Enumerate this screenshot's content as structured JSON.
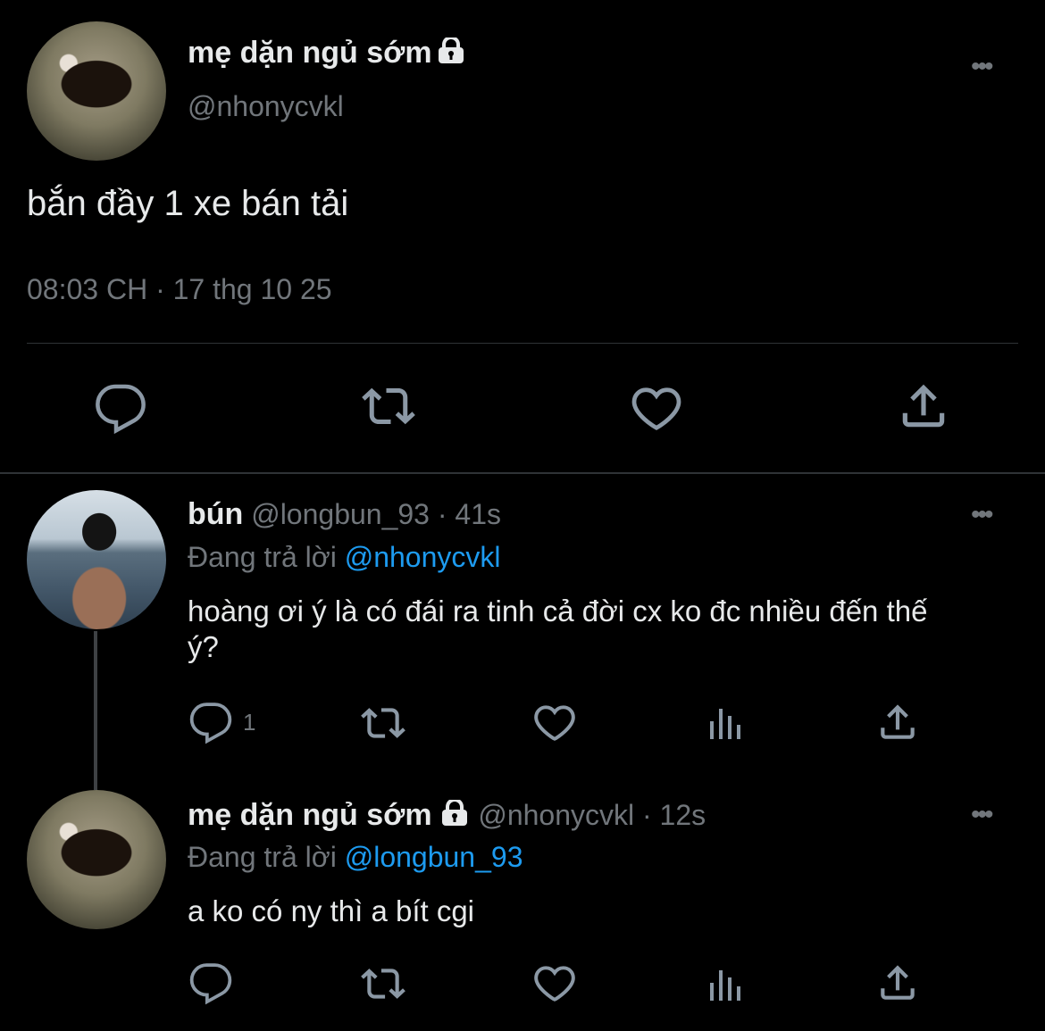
{
  "main_tweet": {
    "display_name": "mẹ dặn ngủ sớm",
    "handle": "@nhonycvkl",
    "text": "bắn đầy 1 xe bán tải",
    "timestamp": "08:03 CH · 17 thg 10 25",
    "more_label": "•••"
  },
  "reply1": {
    "display_name": "bún",
    "handle": "@longbun_93",
    "time": "· 41s",
    "replying_prefix": "Đang trả lời",
    "replying_to": "@nhonycvkl",
    "text_line1": "hoàng ơi ý là có đái ra tinh cả đời cx ko đc nhiều đến thế",
    "text_line2": "ý?",
    "reply_count": "1",
    "more_label": "•••"
  },
  "reply2": {
    "display_name": "mẹ dặn ngủ sớm",
    "handle": "@nhonycvkl",
    "time": "· 12s",
    "replying_prefix": "Đang trả lời",
    "replying_to": "@longbun_93",
    "text": "a ko có ny thì a bít cgi",
    "more_label": "•••"
  },
  "colors": {
    "background": "#000000",
    "text": "#e7e9ea",
    "muted": "#71767b",
    "accent": "#1d9bf0",
    "divider": "#2f3336"
  },
  "icons": [
    "lock-icon",
    "reply-icon",
    "retweet-icon",
    "like-icon",
    "share-icon",
    "views-icon",
    "more-icon"
  ]
}
